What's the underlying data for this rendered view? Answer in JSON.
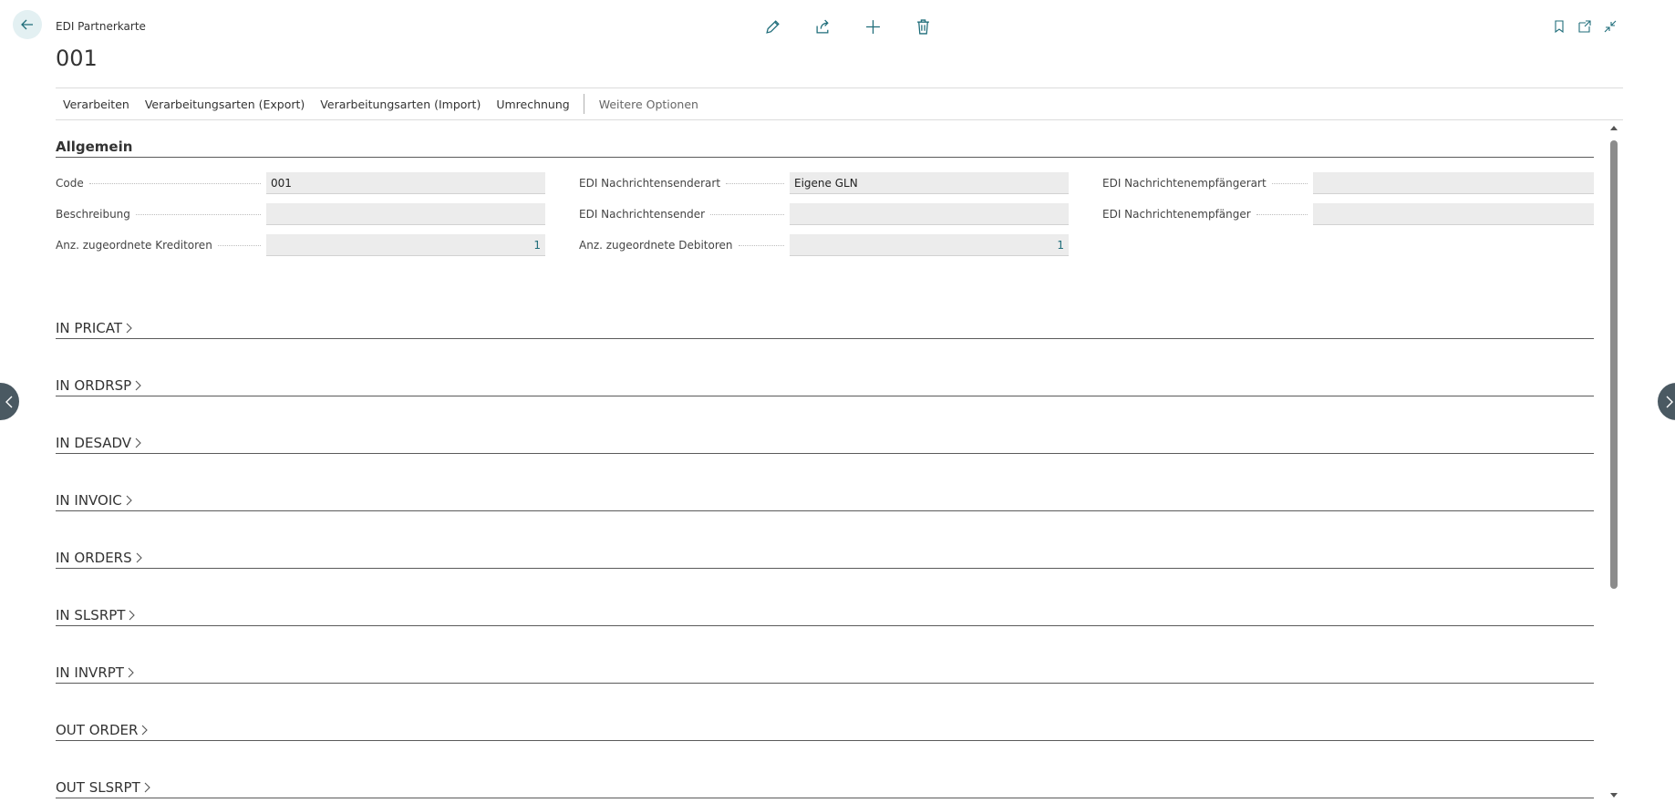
{
  "header": {
    "caption": "EDI Partnerkarte",
    "title": "001",
    "icons": [
      "edit-icon",
      "share-icon",
      "new-icon",
      "delete-icon"
    ],
    "right_icons": [
      "bookmark-icon",
      "open-new-window-icon",
      "collapse-icon"
    ]
  },
  "action_bar": {
    "items": [
      "Verarbeiten",
      "Verarbeitungsarten (Export)",
      "Verarbeitungsarten (Import)",
      "Umrechnung"
    ],
    "more": "Weitere Optionen"
  },
  "general": {
    "title": "Allgemein",
    "col1": [
      {
        "label": "Code",
        "value": "001"
      },
      {
        "label": "Beschreibung",
        "value": ""
      },
      {
        "label": "Anz. zugeordnete Kreditoren",
        "value": "1"
      }
    ],
    "col2": [
      {
        "label": "EDI Nachrichtensenderart",
        "value": "Eigene GLN"
      },
      {
        "label": "EDI Nachrichtensender",
        "value": ""
      },
      {
        "label": "Anz. zugeordnete Debitoren",
        "value": "1"
      }
    ],
    "col3": [
      {
        "label": "EDI  Nachrichtenempfängerart",
        "value": ""
      },
      {
        "label": "EDI  Nachrichtenempfänger",
        "value": ""
      }
    ]
  },
  "tabs": [
    "IN PRICAT",
    "IN ORDRSP",
    "IN DESADV",
    "IN INVOIC",
    "IN ORDERS",
    "IN SLSRPT",
    "IN INVRPT",
    "OUT ORDER",
    "OUT SLSRPT"
  ],
  "colors": {
    "accent": "#1f6d7a",
    "field_bg": "#ececec",
    "nav_button": "#4a5962"
  }
}
